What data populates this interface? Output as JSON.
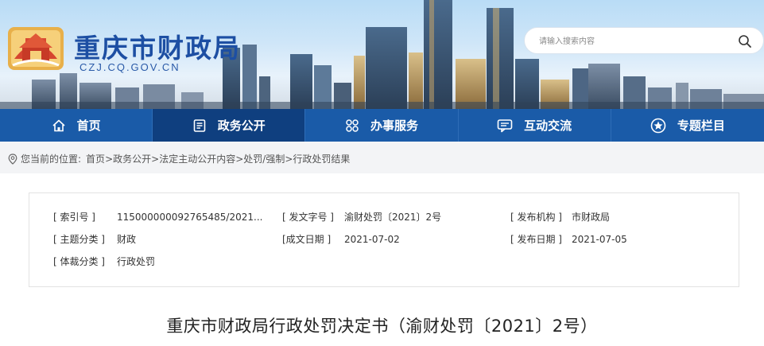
{
  "header": {
    "site_title": "重庆市财政局",
    "site_domain": "CZJ.CQ.GOV.CN",
    "search": {
      "placeholder": "请输入搜索内容"
    }
  },
  "nav": {
    "items": [
      {
        "label": "首页",
        "icon": "home-icon"
      },
      {
        "label": "政务公开",
        "icon": "document-list-icon",
        "active": true
      },
      {
        "label": "办事服务",
        "icon": "grid-icon"
      },
      {
        "label": "互动交流",
        "icon": "chat-icon"
      },
      {
        "label": "专题栏目",
        "icon": "star-icon"
      }
    ]
  },
  "breadcrumb": {
    "prefix": "您当前的位置:",
    "items": [
      "首页",
      "政务公开",
      "法定主动公开内容",
      "处罚/强制",
      "行政处罚结果"
    ],
    "separator": ">"
  },
  "meta": {
    "index_label": "[ 索引号 ]",
    "index_value": "115000000092765485/2021...",
    "doc_no_label": "[ 发文字号 ]",
    "doc_no_value": "渝财处罚〔2021〕2号",
    "issuer_label": "[ 发布机构 ]",
    "issuer_value": "市财政局",
    "topic_label": "[ 主题分类 ]",
    "topic_value": "财政",
    "written_label": "[成文日期 ]",
    "written_value": "2021-07-02",
    "pub_label": "[ 发布日期 ]",
    "pub_value": "2021-07-05",
    "genre_label": "[ 体裁分类 ]",
    "genre_value": "行政处罚"
  },
  "document": {
    "title": "重庆市财政局行政处罚决定书（渝财处罚〔2021〕2号）"
  },
  "colors": {
    "nav_bg": "#1a5ba8",
    "nav_active": "#0f3f7f",
    "brand_blue": "#1d4fa3"
  }
}
